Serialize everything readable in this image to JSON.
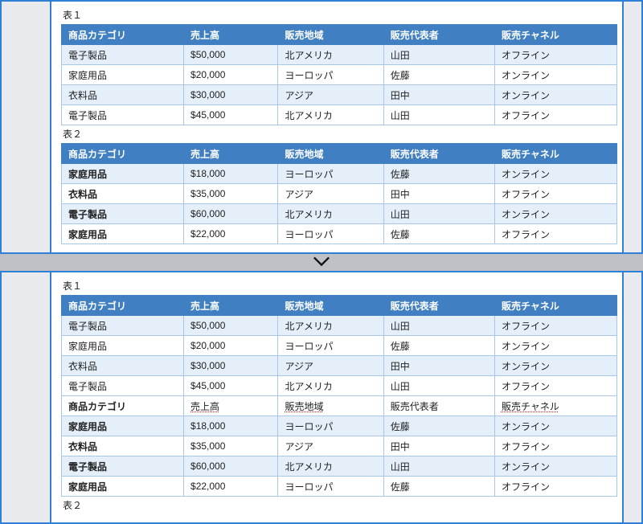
{
  "captions": {
    "t1": "表１",
    "t2": "表２"
  },
  "headers": [
    "商品カテゴリ",
    "売上高",
    "販売地域",
    "販売代表者",
    "販売チャネル"
  ],
  "header_spell_idx": 1,
  "table1_rows": [
    [
      "電子製品",
      "$50,000",
      "北アメリカ",
      "山田",
      "オフライン"
    ],
    [
      "家庭用品",
      "$20,000",
      "ヨーロッパ",
      "佐藤",
      "オンライン"
    ],
    [
      "衣料品",
      "$30,000",
      "アジア",
      "田中",
      "オンライン"
    ],
    [
      "電子製品",
      "$45,000",
      "北アメリカ",
      "山田",
      "オフライン"
    ]
  ],
  "table2_rows": [
    [
      "家庭用品",
      "$18,000",
      "ヨーロッパ",
      "佐藤",
      "オンライン"
    ],
    [
      "衣料品",
      "$35,000",
      "アジア",
      "田中",
      "オフライン"
    ],
    [
      "電子製品",
      "$60,000",
      "北アメリカ",
      "山田",
      "オンライン"
    ],
    [
      "家庭用品",
      "$22,000",
      "ヨーロッパ",
      "佐藤",
      "オフライン"
    ]
  ],
  "mid_header_spell_idx": [
    1,
    2,
    4
  ]
}
